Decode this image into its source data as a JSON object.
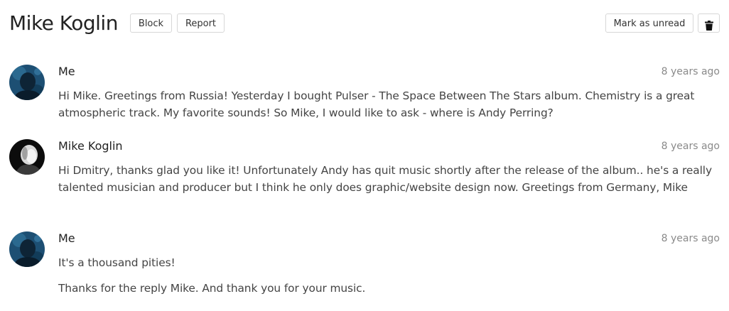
{
  "header": {
    "title": "Mike Koglin",
    "block_label": "Block",
    "report_label": "Report",
    "mark_unread_label": "Mark as unread",
    "delete_icon": "trash-icon"
  },
  "messages": [
    {
      "author": "Me",
      "time": "8 years ago",
      "avatar_icon": "user-avatar",
      "paragraphs": [
        "Hi Mike. Greetings from Russia! Yesterday I bought Pulser - The Space Between The Stars album. Chemistry is a great atmospheric track. My favorite sounds! So Mike, I would like to ask - where is Andy Perring?"
      ]
    },
    {
      "author": "Mike Koglin",
      "time": "8 years ago",
      "avatar_icon": "user-avatar",
      "paragraphs": [
        "Hi Dmitry, thanks glad you like it! Unfortunately Andy has quit music shortly after the release of the album.. he's a really talented musician and producer but I think he only does graphic/website design now. Greetings from Germany, Mike"
      ]
    },
    {
      "author": "Me",
      "time": "8 years ago",
      "avatar_icon": "user-avatar",
      "paragraphs": [
        "It's a thousand pities!",
        "Thanks for the reply Mike. And thank you for your music."
      ]
    }
  ]
}
